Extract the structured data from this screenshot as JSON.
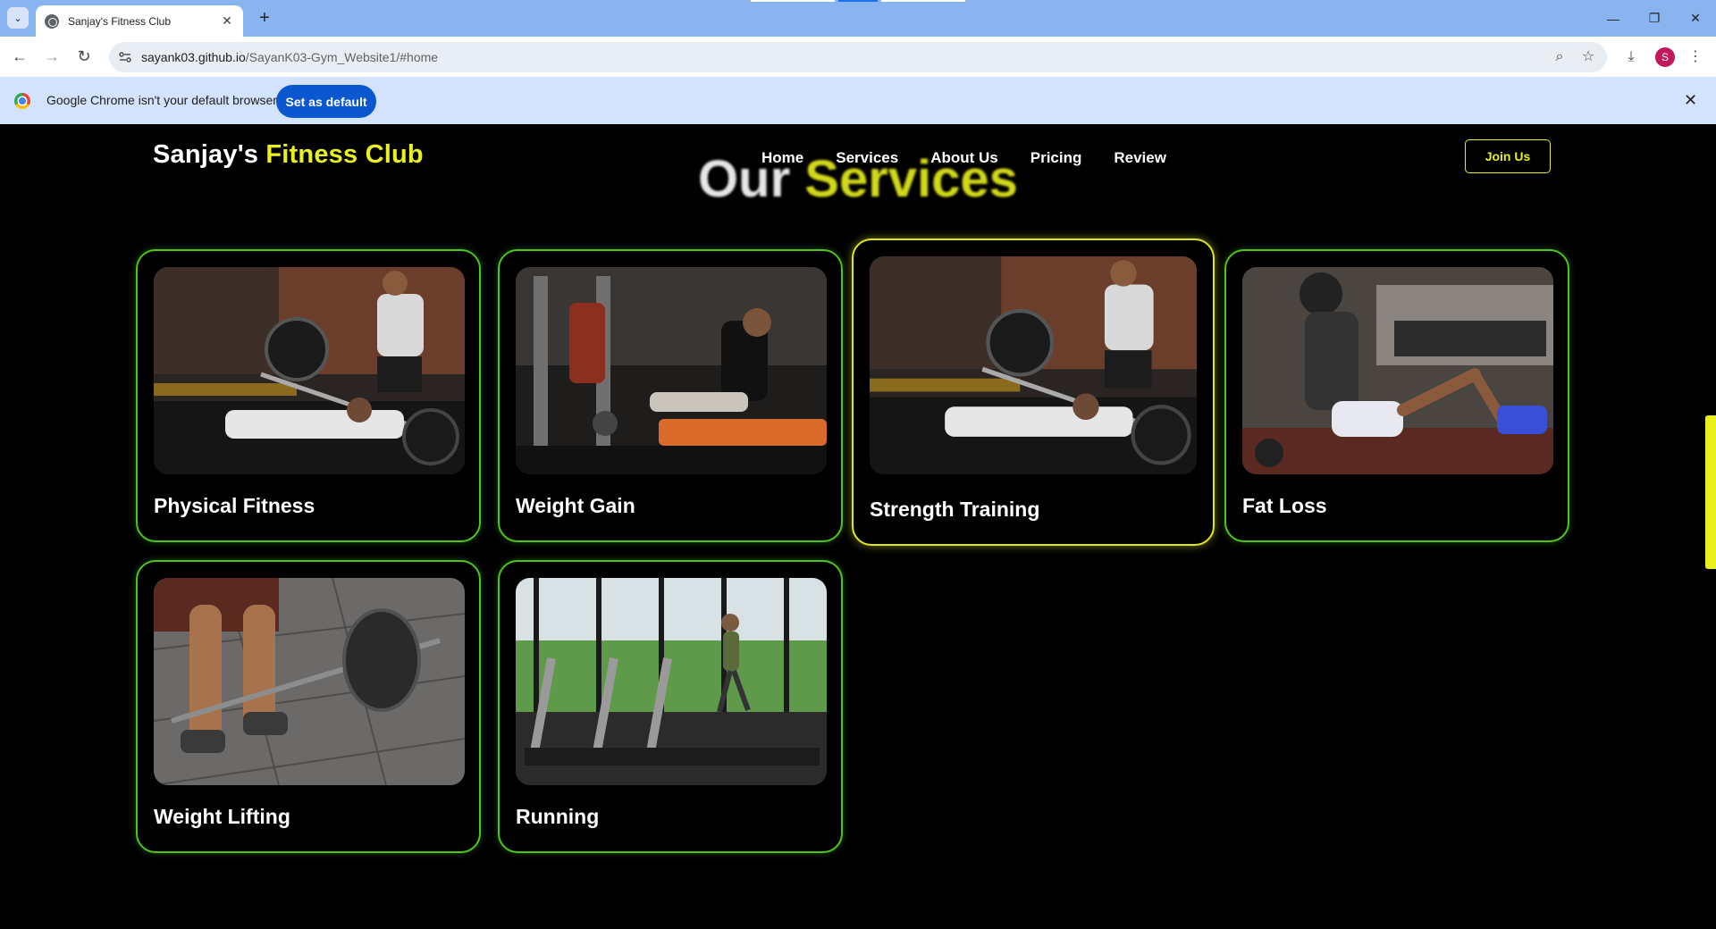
{
  "browser": {
    "tab_title": "Sanjay's Fitness Club",
    "url_host": "sayank03.github.io",
    "url_path": "/SayanK03-Gym_Website1/#home",
    "profile_initial": "S",
    "infobar_text": "Google Chrome isn't your default browser",
    "set_default_label": "Set as default"
  },
  "site": {
    "brand_main": "Sanjay's ",
    "brand_accent": "Fitness Club",
    "nav": [
      "Home",
      "Services",
      "About Us",
      "Pricing",
      "Review"
    ],
    "join_label": "Join Us",
    "section_title_main": "Our ",
    "section_title_accent": "Services"
  },
  "services": [
    {
      "title": "Physical Fitness"
    },
    {
      "title": "Weight Gain"
    },
    {
      "title": "Strength Training"
    },
    {
      "title": "Fat Loss"
    },
    {
      "title": "Weight Lifting"
    },
    {
      "title": "Running"
    }
  ],
  "colors": {
    "accent": "#e9f01d",
    "card_border": "#4ec51a",
    "background": "#000000"
  }
}
